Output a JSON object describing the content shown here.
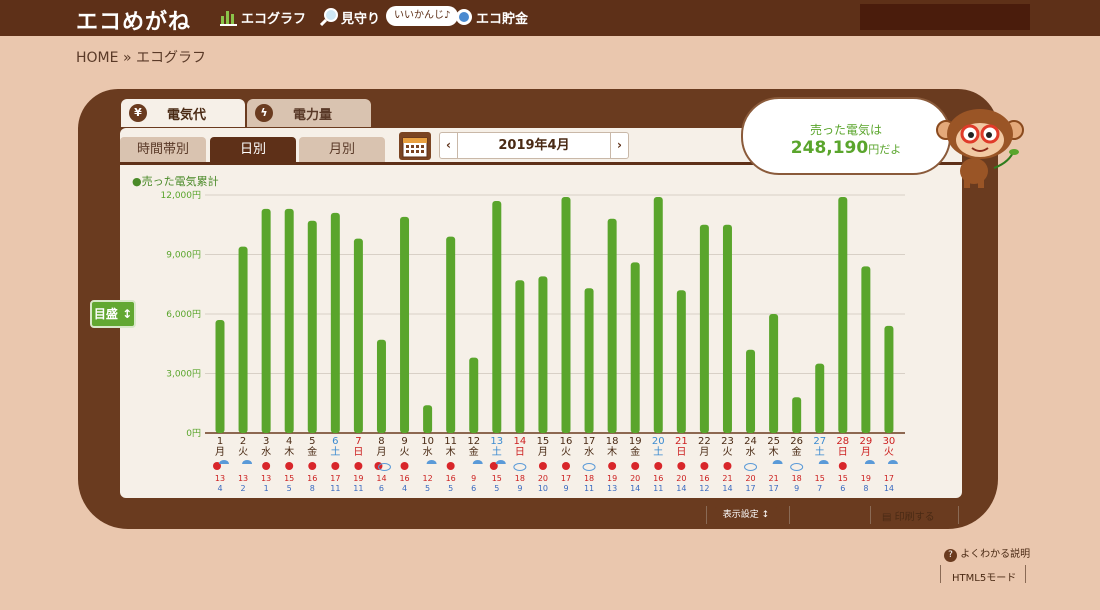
{
  "header": {
    "logo": "エコめがね",
    "nav": [
      {
        "label": "エコグラフ",
        "icon": "bar-chart-icon"
      },
      {
        "label": "見守り",
        "icon": "magnifier-icon"
      },
      {
        "label": "エコ貯金",
        "icon": "piggy-bank-icon"
      }
    ],
    "bubble": "いいかんじ♪"
  },
  "breadcrumb": {
    "home": "HOME",
    "sep": "»",
    "current": "エコグラフ"
  },
  "top_tabs": [
    {
      "label": "電気代",
      "icon": "yen-icon",
      "active": true
    },
    {
      "label": "電力量",
      "icon": "lightning-icon",
      "active": false
    }
  ],
  "sub_tabs": [
    {
      "label": "時間帯別",
      "active": false
    },
    {
      "label": "日別",
      "active": true
    },
    {
      "label": "月別",
      "active": false
    }
  ],
  "month_label": "2019年4月",
  "prev_arrow": "‹",
  "next_arrow": "›",
  "sold": {
    "label": "売った電気は",
    "amount": "248,190",
    "suffix": "円だよ"
  },
  "mode_label": "目盛",
  "chart_data": {
    "type": "bar",
    "title": "",
    "legend": "売った電気累計",
    "ylabel": "",
    "ylim": [
      0,
      12000
    ],
    "yticks": [
      {
        "v": 0,
        "label": "0円"
      },
      {
        "v": 3000,
        "label": "3,000円"
      },
      {
        "v": 6000,
        "label": "6,000円"
      },
      {
        "v": 9000,
        "label": "9,000円"
      },
      {
        "v": 12000,
        "label": "12,000円"
      }
    ],
    "color": "#5aa52c",
    "days": [
      "1",
      "2",
      "3",
      "4",
      "5",
      "6",
      "7",
      "8",
      "9",
      "10",
      "11",
      "12",
      "13",
      "14",
      "15",
      "16",
      "17",
      "18",
      "19",
      "20",
      "21",
      "22",
      "23",
      "24",
      "25",
      "26",
      "27",
      "28",
      "29",
      "30"
    ],
    "weekdays": [
      "月",
      "火",
      "水",
      "木",
      "金",
      "土",
      "日",
      "月",
      "火",
      "水",
      "木",
      "金",
      "土",
      "日",
      "月",
      "火",
      "水",
      "木",
      "金",
      "土",
      "日",
      "月",
      "火",
      "水",
      "木",
      "金",
      "土",
      "日",
      "月",
      "火"
    ],
    "day_colors": [
      "#4a2a14",
      "#4a2a14",
      "#4a2a14",
      "#4a2a14",
      "#4a2a14",
      "#3a8ad0",
      "#cc1f1f",
      "#4a2a14",
      "#4a2a14",
      "#4a2a14",
      "#4a2a14",
      "#4a2a14",
      "#3a8ad0",
      "#cc1f1f",
      "#4a2a14",
      "#4a2a14",
      "#4a2a14",
      "#4a2a14",
      "#4a2a14",
      "#3a8ad0",
      "#cc1f1f",
      "#4a2a14",
      "#4a2a14",
      "#4a2a14",
      "#4a2a14",
      "#4a2a14",
      "#3a8ad0",
      "#cc1f1f",
      "#cc1f1f",
      "#cc1f1f"
    ],
    "values": [
      5700,
      9400,
      11300,
      11300,
      10700,
      11100,
      9800,
      4700,
      10900,
      1400,
      9900,
      3800,
      11700,
      7700,
      7900,
      11900,
      7300,
      10800,
      8600,
      11900,
      7200,
      10500,
      10500,
      4200,
      6000,
      1800,
      3500,
      11900,
      8400,
      5400
    ],
    "weather": [
      "sun-rain",
      "rain",
      "sun",
      "sun",
      "sun",
      "sun",
      "sun",
      "sun-cloud",
      "sun",
      "rain",
      "sun",
      "rain",
      "sun-rain",
      "cloud",
      "sun",
      "sun",
      "cloud",
      "sun",
      "sun",
      "sun",
      "sun",
      "sun",
      "sun",
      "cloud",
      "rain",
      "cloud",
      "rain",
      "sun",
      "rain",
      "rain"
    ],
    "temp_high": [
      "13",
      "13",
      "13",
      "15",
      "16",
      "17",
      "19",
      "14",
      "16",
      "12",
      "16",
      "9",
      "15",
      "18",
      "20",
      "17",
      "18",
      "19",
      "20",
      "16",
      "20",
      "16",
      "21",
      "20",
      "21",
      "18",
      "15",
      "15",
      "19",
      "17"
    ],
    "temp_low": [
      "4",
      "2",
      "1",
      "5",
      "8",
      "11",
      "11",
      "6",
      "4",
      "5",
      "5",
      "6",
      "5",
      "9",
      "10",
      "9",
      "11",
      "13",
      "14",
      "11",
      "14",
      "12",
      "14",
      "17",
      "17",
      "9",
      "7",
      "6",
      "8",
      "14"
    ]
  },
  "footer": {
    "display_settings": "表示設定",
    "print": "印刷する",
    "help": "よくわかる説明",
    "html5": "HTML5モード"
  }
}
